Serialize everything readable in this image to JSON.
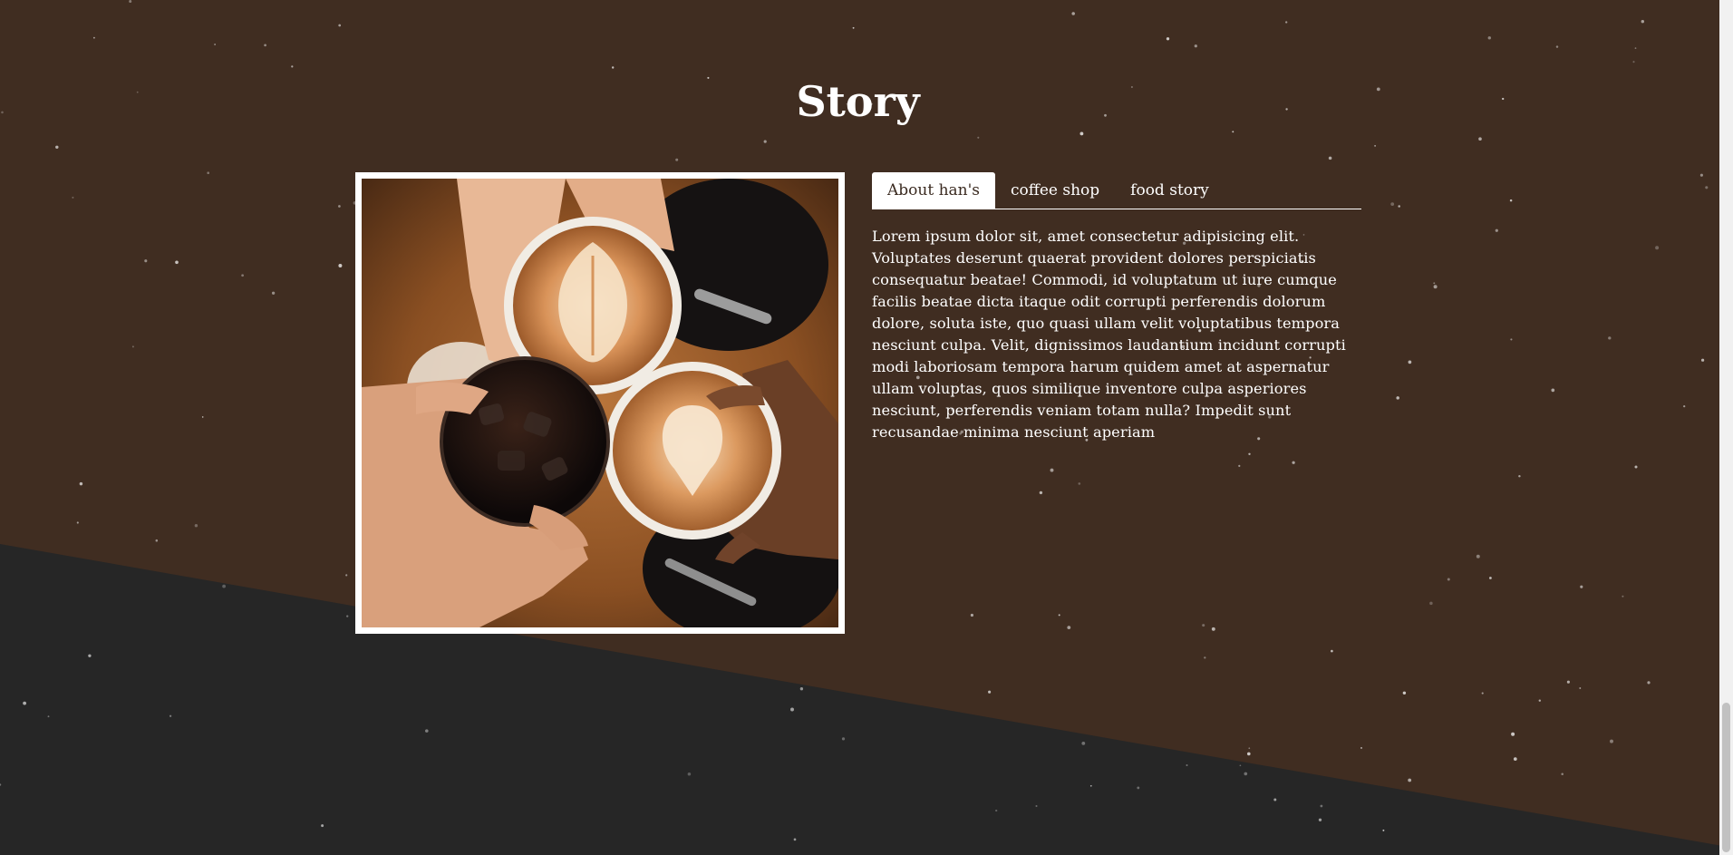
{
  "section": {
    "title": "Story"
  },
  "tabs": [
    {
      "label": "About han's",
      "active": true
    },
    {
      "label": "coffee shop",
      "active": false
    },
    {
      "label": "food story",
      "active": false
    }
  ],
  "content": {
    "text": "Lorem ipsum dolor sit, amet consectetur adipisicing elit. Voluptates deserunt quaerat provident dolores perspiciatis consequatur beatae! Commodi, id voluptatum ut iure cumque facilis beatae dicta itaque odit corrupti perferendis dolorum dolore, soluta iste, quo quasi ullam velit voluptatibus tempora nesciunt culpa. Velit, dignissimos laudantium incidunt corrupti modi laboriosam tempora harum quidem amet at aspernatur ullam voluptas, quos similique inventore culpa asperiores nesciunt, perferendis veniam totam nulla? Impedit sunt recusandae minima nesciunt aperiam"
  },
  "image": {
    "subject": "coffee-cups-cheers-photo"
  },
  "colors": {
    "background_brown": "#402d21",
    "background_dark": "#262626",
    "text": "#ffffff"
  }
}
